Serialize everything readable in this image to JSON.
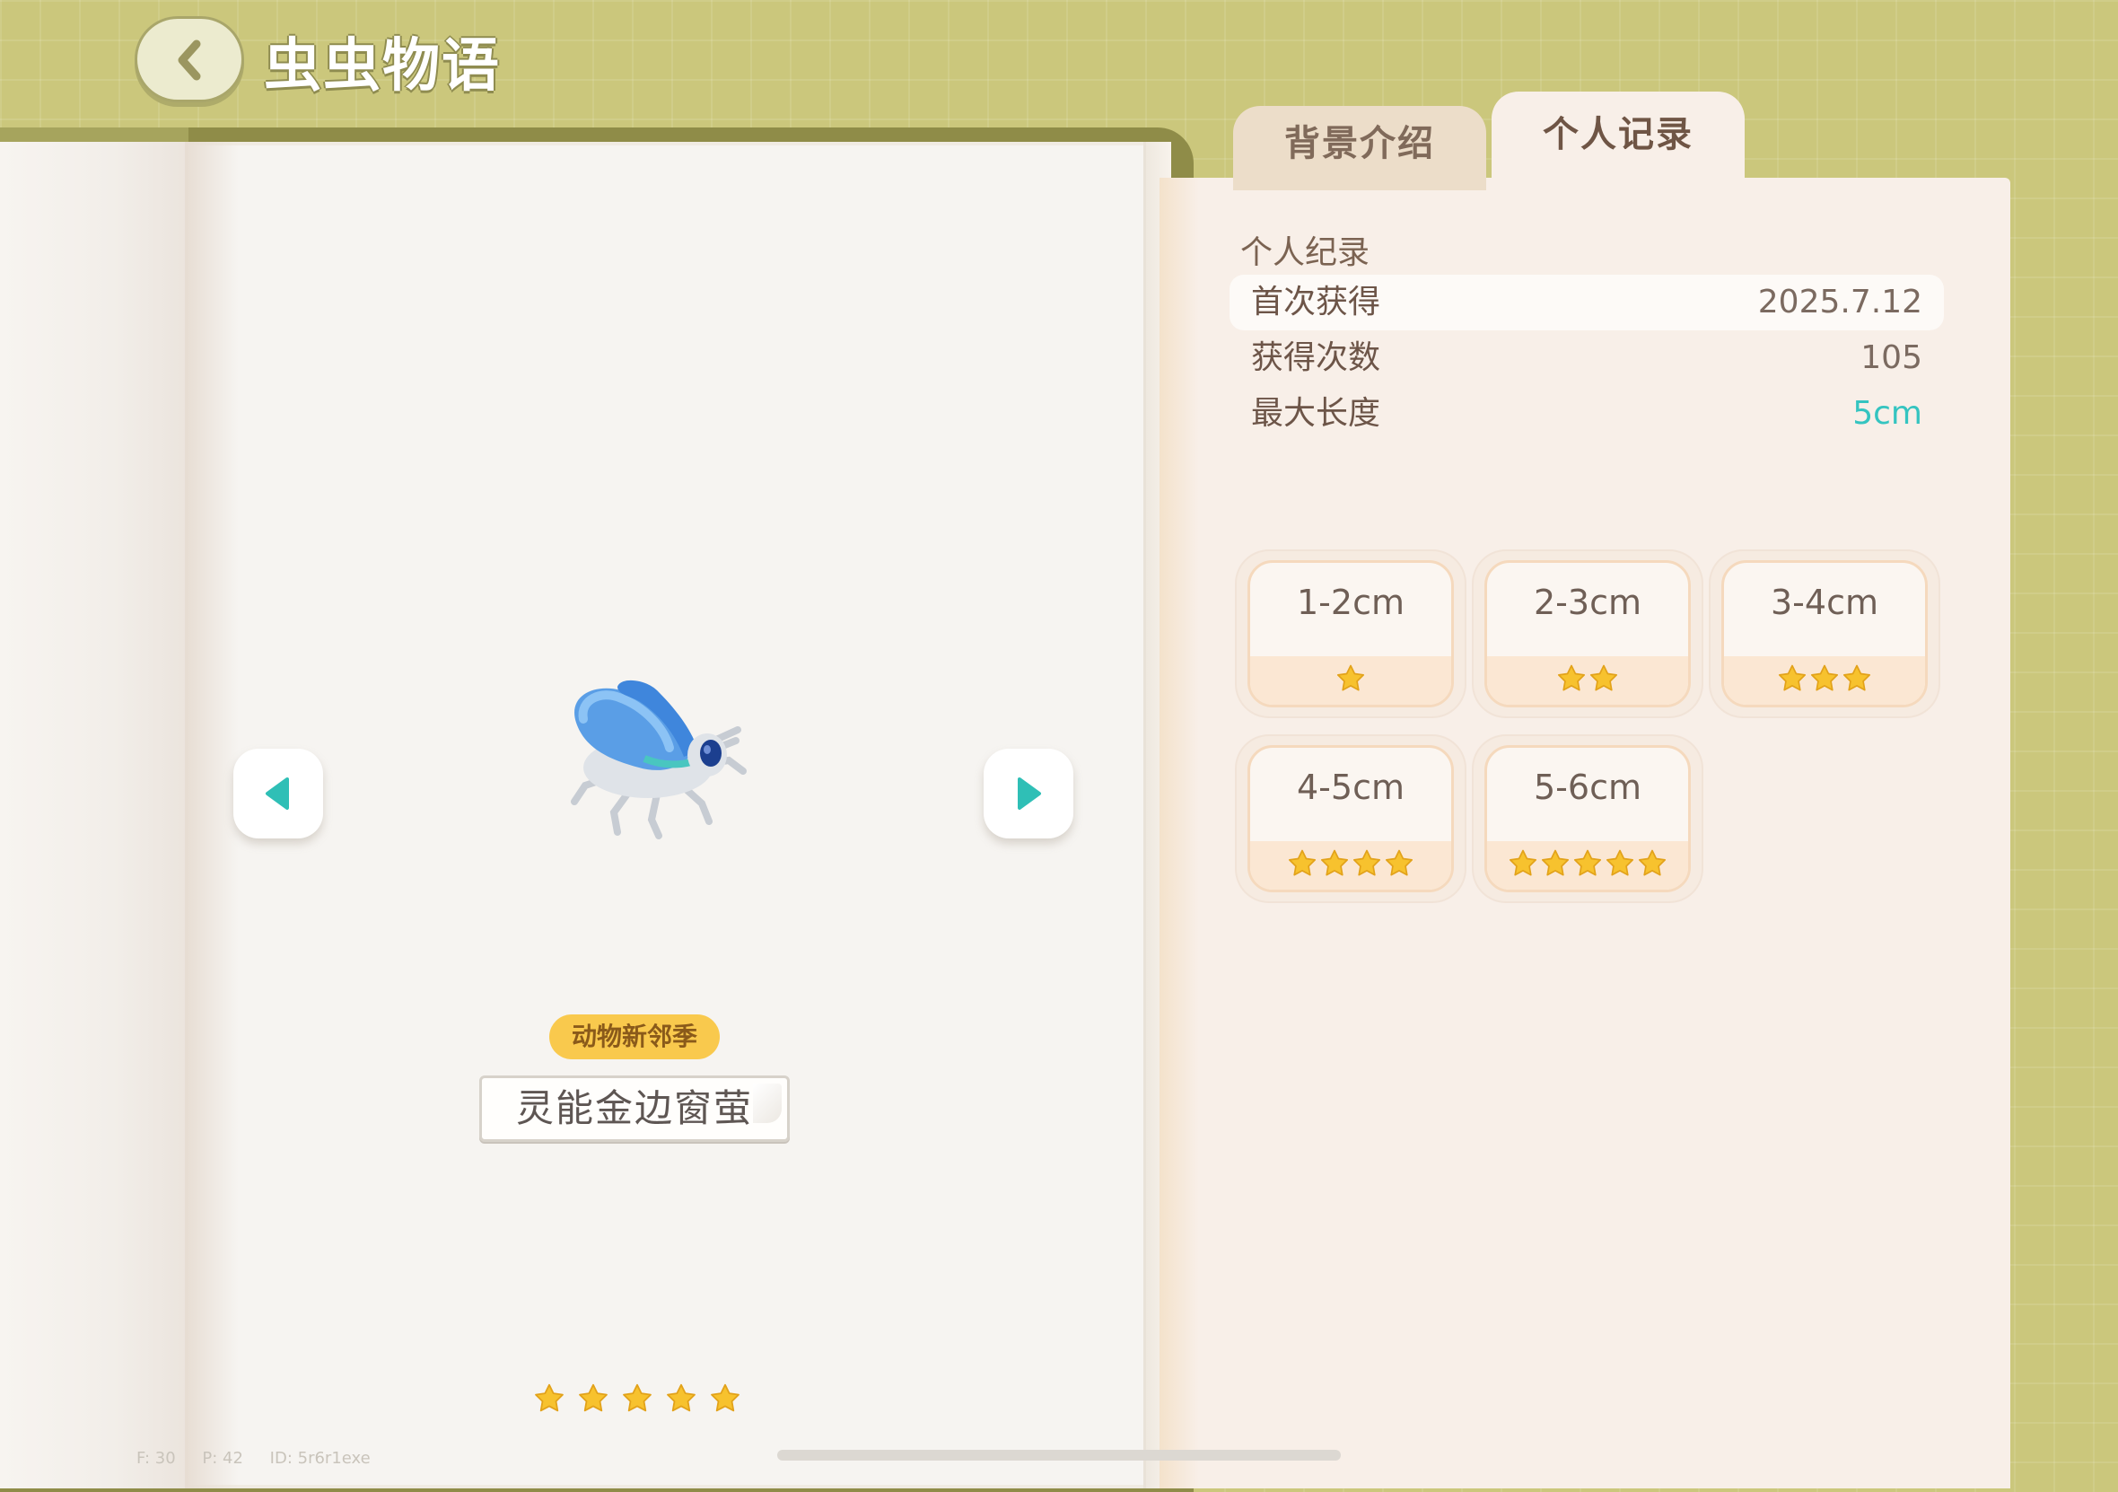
{
  "header": {
    "title": "虫虫物语"
  },
  "left_page": {
    "creature_image": "blue-beetle-model",
    "season_badge": "动物新邻季",
    "creature_name": "灵能金边窗萤",
    "rarity_stars": 5
  },
  "tabs": [
    {
      "label": "背景介绍",
      "active": false
    },
    {
      "label": "个人记录",
      "active": true
    }
  ],
  "record": {
    "section_title": "个人纪录",
    "first_obtained_label": "首次获得",
    "first_obtained_value": "2025.7.12",
    "times_obtained_label": "获得次数",
    "times_obtained_value": "105",
    "max_length_label": "最大长度",
    "max_length_value": "5cm"
  },
  "size_tiers": [
    {
      "label": "1-2cm",
      "stars": 1
    },
    {
      "label": "2-3cm",
      "stars": 2
    },
    {
      "label": "3-4cm",
      "stars": 3
    },
    {
      "label": "4-5cm",
      "stars": 4
    },
    {
      "label": "5-6cm",
      "stars": 5
    }
  ],
  "debug": {
    "fps": "F: 30",
    "ping": "P: 42",
    "id": "ID: 5r6r1exe"
  },
  "colors": {
    "background": "#cbc77c",
    "accent_teal": "#34c4c0",
    "star_yellow": "#f7c22e",
    "badge_yellow": "#f9c94d"
  }
}
